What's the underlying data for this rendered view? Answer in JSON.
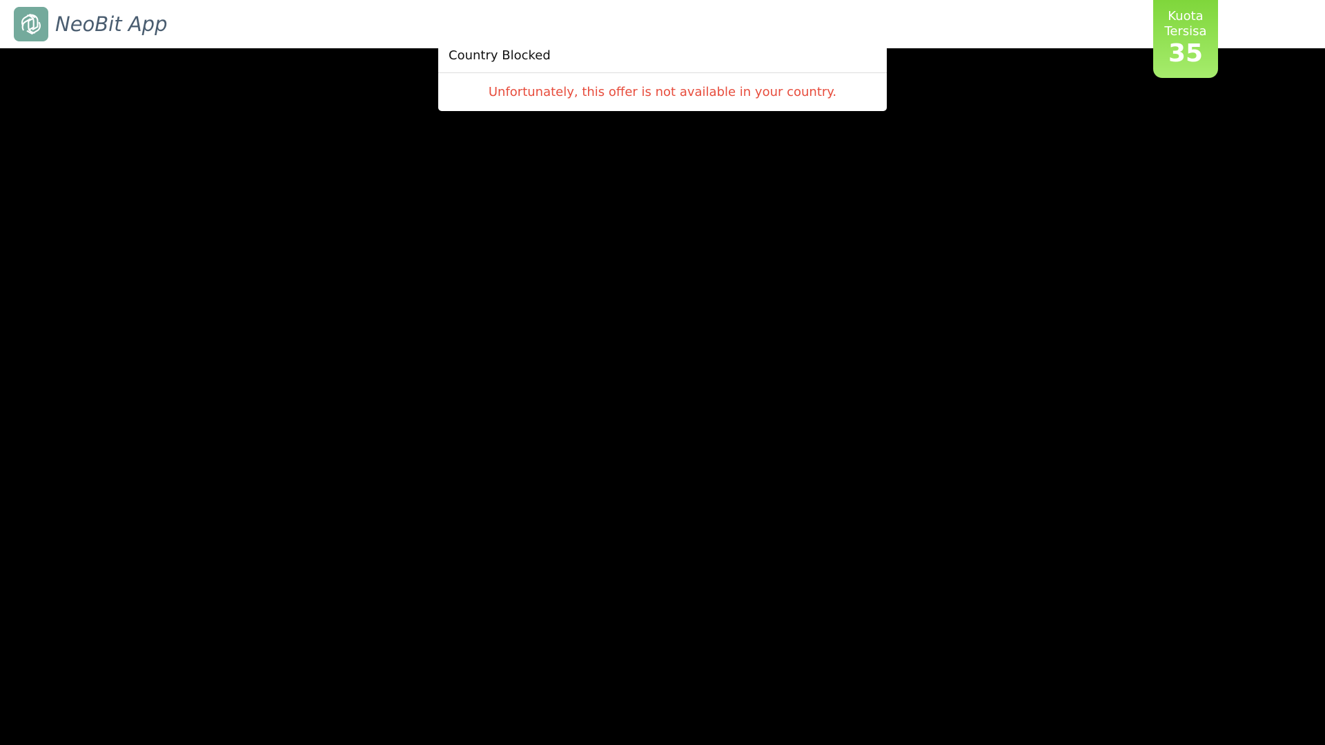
{
  "header": {
    "logo_icon": "openai-knot-icon",
    "app_name": "NeoBit App",
    "brand_color": "#74aa9c"
  },
  "quota": {
    "label": "Kuota Tersisa",
    "value": "35",
    "color": "#8ee04f"
  },
  "modal": {
    "title": "Country Blocked",
    "message": "Unfortunately, this offer is not available in your country.",
    "message_color": "#e74c3c"
  }
}
